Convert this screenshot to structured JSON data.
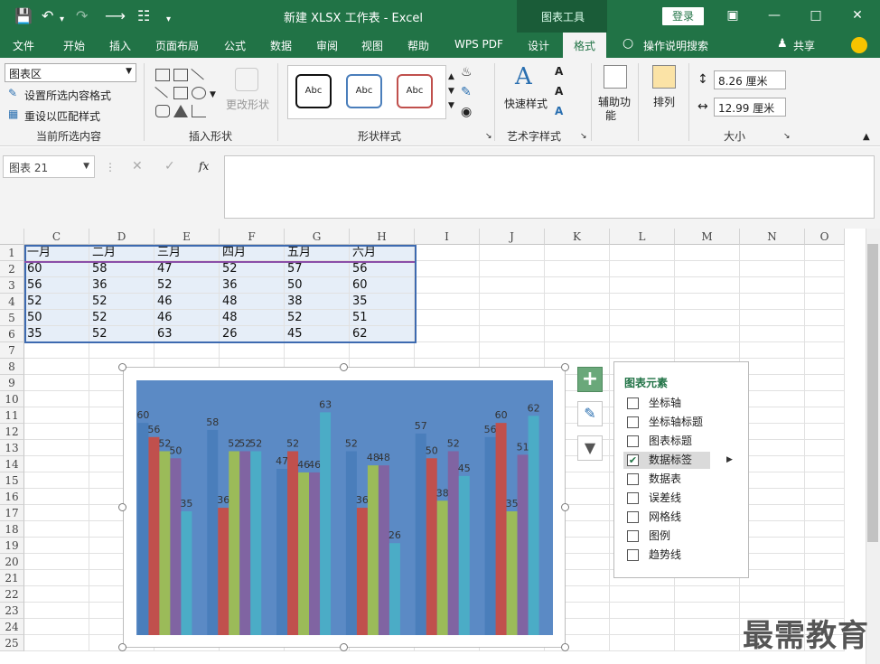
{
  "titlebar": {
    "title": "新建 XLSX 工作表  -  Excel",
    "context_tab": "图表工具",
    "login": "登录",
    "accent": "#217346"
  },
  "tabs": [
    {
      "label": "文件"
    },
    {
      "label": "开始"
    },
    {
      "label": "插入"
    },
    {
      "label": "页面布局"
    },
    {
      "label": "公式"
    },
    {
      "label": "数据"
    },
    {
      "label": "审阅"
    },
    {
      "label": "视图"
    },
    {
      "label": "帮助"
    },
    {
      "label": "WPS PDF"
    },
    {
      "label": "设计"
    },
    {
      "label": "格式"
    }
  ],
  "tell_me": "操作说明搜索",
  "share": "共享",
  "ribbon": {
    "current_selection": {
      "dropdown_value": "图表区",
      "format_selection": "设置所选内容格式",
      "reset_style": "重设以匹配样式",
      "label": "当前所选内容"
    },
    "insert_shapes": {
      "change_shape": "更改形状",
      "label": "插入形状"
    },
    "shape_styles": {
      "styles": [
        "Abc",
        "Abc",
        "Abc"
      ],
      "label": "形状样式"
    },
    "wordart": {
      "quick_styles": "快速样式",
      "label": "艺术字样式"
    },
    "accessibility": {
      "label_line1": "辅助功",
      "label_line2": "能"
    },
    "arrange": {
      "label": "排列"
    },
    "size": {
      "height": "8.26 厘米",
      "width": "12.99 厘米",
      "label": "大小"
    }
  },
  "formula_bar": {
    "name_box": "图表 21",
    "fx": "fx"
  },
  "columns": [
    "C",
    "D",
    "E",
    "F",
    "G",
    "H",
    "I",
    "J",
    "K",
    "L",
    "M",
    "N",
    "O"
  ],
  "rows": [
    "1",
    "2",
    "3",
    "4",
    "5",
    "6",
    "7",
    "8",
    "9",
    "10",
    "11",
    "12",
    "13",
    "14",
    "15",
    "16",
    "17",
    "18",
    "19",
    "20",
    "21",
    "22",
    "23",
    "24",
    "25"
  ],
  "table": {
    "header": [
      "一月",
      "二月",
      "三月",
      "四月",
      "五月",
      "六月"
    ],
    "rows": [
      [
        "60",
        "58",
        "47",
        "52",
        "57",
        "56"
      ],
      [
        "56",
        "36",
        "52",
        "36",
        "50",
        "60"
      ],
      [
        "52",
        "52",
        "46",
        "48",
        "38",
        "35"
      ],
      [
        "50",
        "52",
        "46",
        "48",
        "52",
        "51"
      ],
      [
        "35",
        "52",
        "63",
        "26",
        "45",
        "62"
      ]
    ]
  },
  "chart_data": {
    "type": "bar",
    "categories": [
      "一月",
      "二月",
      "三月",
      "四月",
      "五月",
      "六月"
    ],
    "series": [
      {
        "values": [
          60,
          58,
          47,
          52,
          57,
          56
        ],
        "color": "#4a7ebb"
      },
      {
        "values": [
          56,
          36,
          52,
          36,
          50,
          60
        ],
        "color": "#c0504d"
      },
      {
        "values": [
          52,
          52,
          46,
          48,
          38,
          35
        ],
        "color": "#9bbb59"
      },
      {
        "values": [
          50,
          52,
          46,
          48,
          52,
          51
        ],
        "color": "#8064a2"
      },
      {
        "values": [
          35,
          52,
          63,
          26,
          45,
          62
        ],
        "color": "#4bacc6"
      }
    ],
    "ylim": [
      0,
      70
    ],
    "data_labels": true,
    "grid": false,
    "legend": false,
    "background": "#5b8ac5"
  },
  "chart_elements_panel": {
    "title": "图表元素",
    "items": [
      {
        "label": "坐标轴",
        "checked": false
      },
      {
        "label": "坐标轴标题",
        "checked": false
      },
      {
        "label": "图表标题",
        "checked": false
      },
      {
        "label": "数据标签",
        "checked": true
      },
      {
        "label": "数据表",
        "checked": false
      },
      {
        "label": "误差线",
        "checked": false
      },
      {
        "label": "网格线",
        "checked": false
      },
      {
        "label": "图例",
        "checked": false
      },
      {
        "label": "趋势线",
        "checked": false
      }
    ]
  },
  "watermark": "最需教育"
}
